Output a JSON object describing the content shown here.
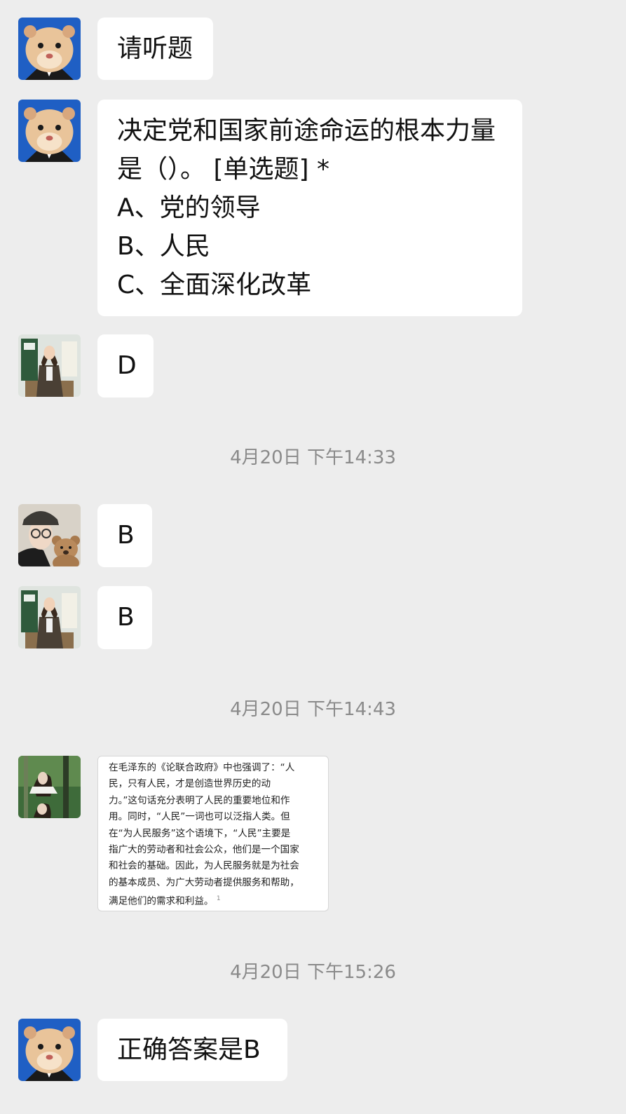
{
  "messages": [
    {
      "type": "text",
      "lines": [
        "请听题"
      ]
    },
    {
      "type": "text",
      "lines": [
        "决定党和国家前途命运的根本力量",
        "是（）。 [单选题] *",
        "A、党的领导",
        "B、人民",
        "C、全面深化改革"
      ]
    },
    {
      "type": "text",
      "lines": [
        "D"
      ]
    },
    {
      "type": "time",
      "text": "4月20日 下午14:33"
    },
    {
      "type": "text",
      "lines": [
        "B"
      ]
    },
    {
      "type": "text",
      "lines": [
        "B"
      ]
    },
    {
      "type": "time",
      "text": "4月20日 下午14:43"
    },
    {
      "type": "image_text",
      "lines": [
        "在毛泽东的《论联合政府》中也强调了：“人",
        "民，只有人民，才是创造世界历史的动",
        "力。”这句话充分表明了人民的重要地位和作",
        "用。同时，“人民”一词也可以泛指人类。但",
        "在“为人民服务”这个语境下，“人民”主要是",
        "指广大的劳动者和社会公众，他们是一个国家",
        "和社会的基础。因此，为人民服务就是为社会",
        "的基本成员、为广大劳动者提供服务和帮助，",
        "满足他们的需求和利益。"
      ],
      "footnote": "1"
    },
    {
      "type": "time",
      "text": "4月20日 下午15:26"
    },
    {
      "type": "text",
      "lines": [
        "正确答案是B"
      ]
    }
  ],
  "avatars": {
    "hamster": {
      "icon": "hamster-avatar",
      "bg": "#1f5fc4"
    },
    "woman_suit": {
      "icon": "woman-suit-avatar",
      "bg": "#2f5a3c"
    },
    "woman_bear": {
      "icon": "woman-bear-avatar",
      "bg": "#c9c2b8"
    },
    "woman_forest": {
      "icon": "woman-forest-avatar",
      "bg": "#3e6b3a"
    }
  },
  "colors": {
    "background": "#ededed",
    "bubble": "#ffffff",
    "timestamp": "#8a8a8a"
  }
}
